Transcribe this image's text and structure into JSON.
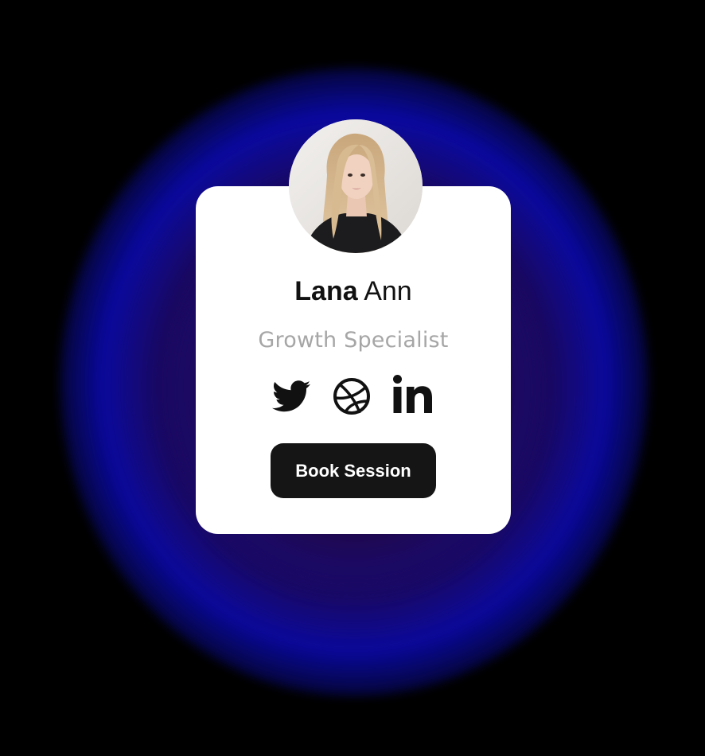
{
  "profile": {
    "first_name": "Lana",
    "last_name": "Ann",
    "role": "Growth Specialist",
    "avatar_icon": "profile-photo"
  },
  "social_links": [
    {
      "icon": "twitter-icon"
    },
    {
      "icon": "dribbble-icon"
    },
    {
      "icon": "linkedin-icon"
    }
  ],
  "cta": {
    "label": "Book Session"
  },
  "colors": {
    "page_background": "#000000",
    "glow": "#0c0a96",
    "card_background": "#ffffff",
    "name_text": "#111111",
    "role_text": "#a6a6a6",
    "button_background": "#151515",
    "button_text": "#ffffff"
  }
}
